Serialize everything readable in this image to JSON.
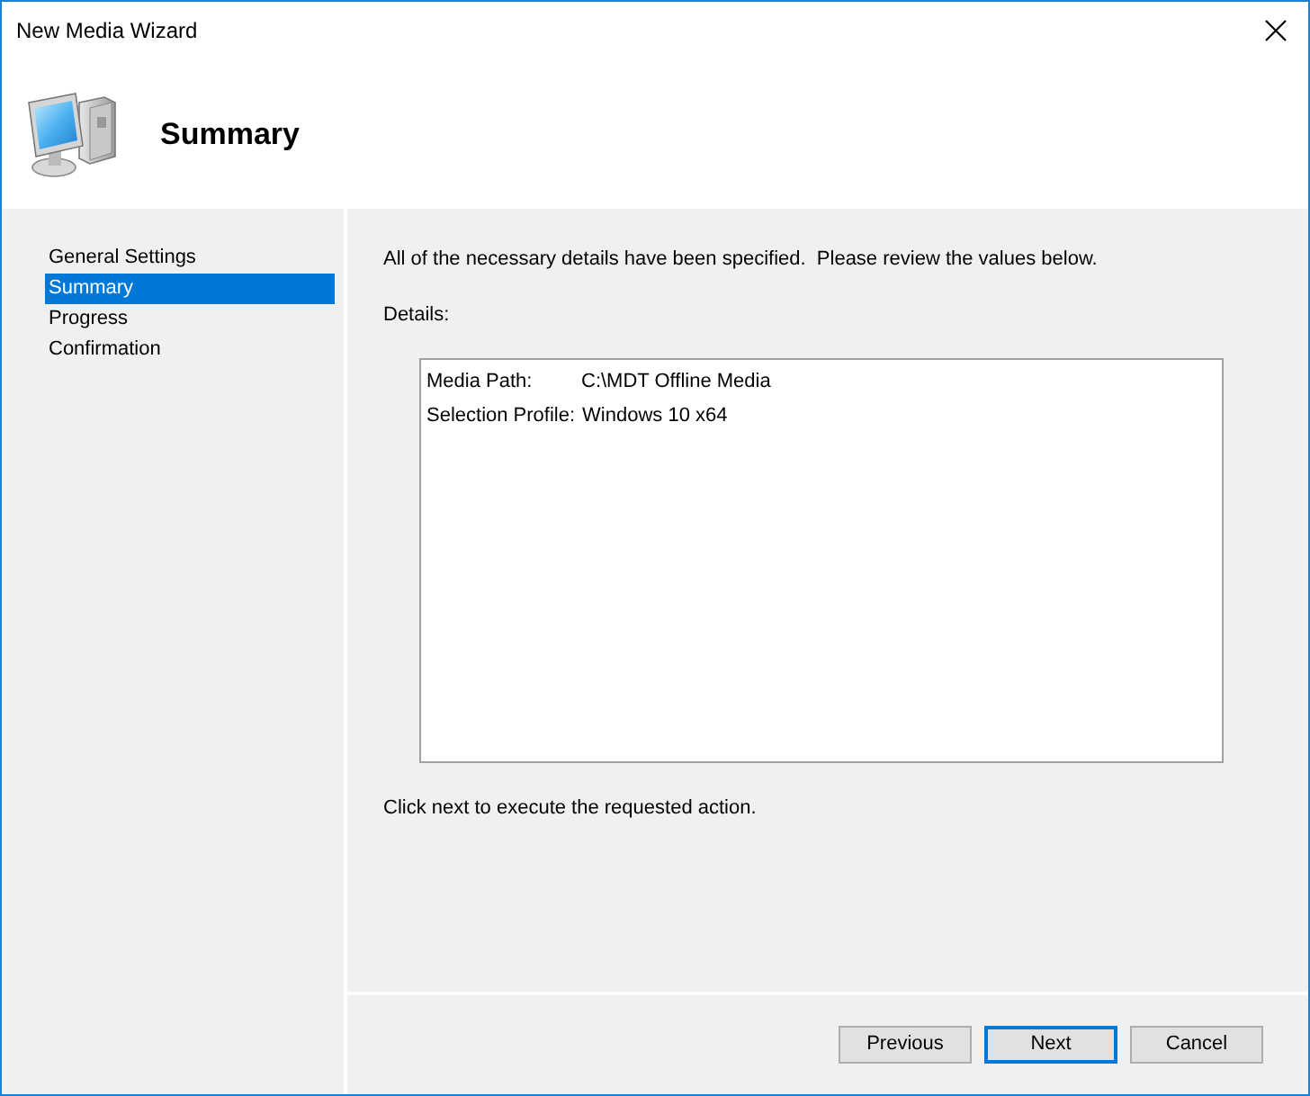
{
  "window": {
    "title": "New Media Wizard"
  },
  "header": {
    "title": "Summary"
  },
  "steps": [
    {
      "label": "General Settings",
      "selected": false
    },
    {
      "label": "Summary",
      "selected": true
    },
    {
      "label": "Progress",
      "selected": false
    },
    {
      "label": "Confirmation",
      "selected": false
    }
  ],
  "intro": "All of the necessary details have been specified.  Please review the values below.",
  "details_label": "Details:",
  "details": [
    {
      "name": "Media Path:",
      "value": "C:\\MDT Offline Media"
    },
    {
      "name": "Selection Profile:",
      "value": "Windows 10 x64"
    }
  ],
  "footer_note": "Click next to execute the requested action.",
  "buttons": [
    {
      "label": "Previous",
      "default": false
    },
    {
      "label": "Next",
      "default": true
    },
    {
      "label": "Cancel",
      "default": false
    }
  ]
}
